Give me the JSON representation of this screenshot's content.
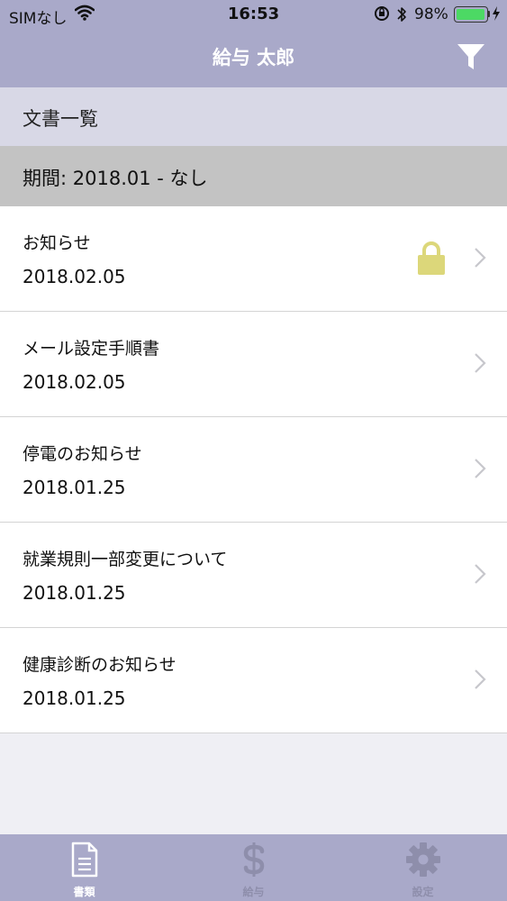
{
  "status_bar": {
    "carrier": "SIMなし",
    "time": "16:53",
    "battery_percent": "98%",
    "battery_level": 0.98
  },
  "nav": {
    "title": "給与 太郎",
    "filter_icon": "filter-icon"
  },
  "section": {
    "title": "文書一覧"
  },
  "period": {
    "label": "期間: 2018.01 - なし"
  },
  "documents": [
    {
      "title": "お知らせ",
      "date": "2018.02.05",
      "locked": true
    },
    {
      "title": "メール設定手順書",
      "date": "2018.02.05",
      "locked": false
    },
    {
      "title": "停電のお知らせ",
      "date": "2018.01.25",
      "locked": false
    },
    {
      "title": "就業規則一部変更について",
      "date": "2018.01.25",
      "locked": false
    },
    {
      "title": "健康診断のお知らせ",
      "date": "2018.01.25",
      "locked": false
    }
  ],
  "tabs": [
    {
      "label": "書類",
      "icon": "document-icon",
      "active": true
    },
    {
      "label": "給与",
      "icon": "dollar-icon",
      "active": false
    },
    {
      "label": "設定",
      "icon": "gear-icon",
      "active": false
    }
  ],
  "colors": {
    "header_bg": "#a9a9c9",
    "section_bg": "#d8d8e6",
    "period_bg": "#c3c3c3",
    "lock": "#dcd77a",
    "battery": "#4cd964"
  }
}
